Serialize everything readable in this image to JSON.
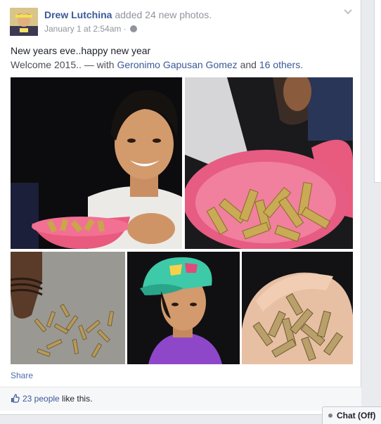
{
  "post": {
    "author": "Drew Lutchina",
    "action": "added 24 new photos.",
    "timestamp": "January 1 at 2:54am",
    "separator": "·",
    "privacy_icon": "globe-icon",
    "status_line1": "New years eve..happy new year",
    "status_line2_prefix": "Welcome 2015.. — with ",
    "tagged_person": "Geronimo Gapusan Gomez",
    "and_text": " and ",
    "others": "16 others",
    "period": ".",
    "share_label": "Share",
    "likes_count": "23 people",
    "likes_suffix": " like this.",
    "photos": [
      {
        "name": "photo-smiling-boy-with-basin"
      },
      {
        "name": "photo-basin-of-bullet-casings"
      },
      {
        "name": "photo-hand-with-casings"
      },
      {
        "name": "photo-person-in-cap"
      },
      {
        "name": "photo-handful-of-casings"
      }
    ]
  },
  "chat": {
    "label": "Chat (Off)"
  },
  "colors": {
    "link": "#3b5998",
    "muted": "#90949c",
    "background": "#e9ebee"
  }
}
